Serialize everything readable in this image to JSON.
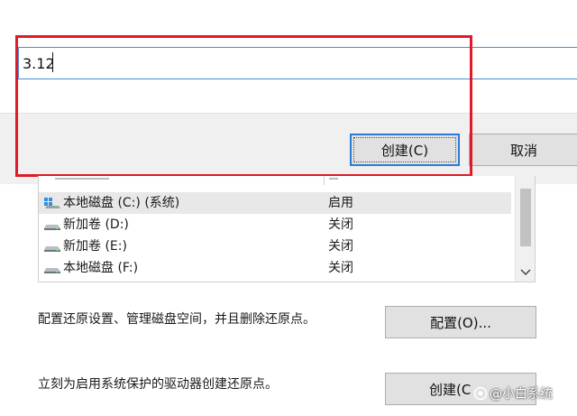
{
  "name_input": {
    "value": "3.12"
  },
  "buttons": {
    "create_top": "创建(C)",
    "cancel": "取消",
    "config": "配置(O)...",
    "create_bottom": "创建(C"
  },
  "drives": [
    {
      "name": "本地磁盘 (C:) (系统)",
      "status": "启用",
      "icon": "system-drive-icon",
      "selected": true
    },
    {
      "name": "新加卷 (D:)",
      "status": "关闭",
      "icon": "drive-icon",
      "selected": false
    },
    {
      "name": "新加卷 (E:)",
      "status": "关闭",
      "icon": "drive-icon",
      "selected": false
    },
    {
      "name": "本地磁盘 (F:)",
      "status": "关闭",
      "icon": "drive-icon",
      "selected": false
    }
  ],
  "texts": {
    "config_description": "配置还原设置、管理磁盘空间，并且删除还原点。",
    "create_description": "立刻为启用系统保护的驱动器创建还原点。"
  },
  "watermark": {
    "text": "@小白系统"
  },
  "colors": {
    "highlight_frame": "#e11b26",
    "focus_border": "#2a7dd6",
    "input_border": "#4a90d9",
    "button_face": "#e1e1e1",
    "dialog_band": "#f0f0f0",
    "selected_row": "#e8e8e8"
  }
}
